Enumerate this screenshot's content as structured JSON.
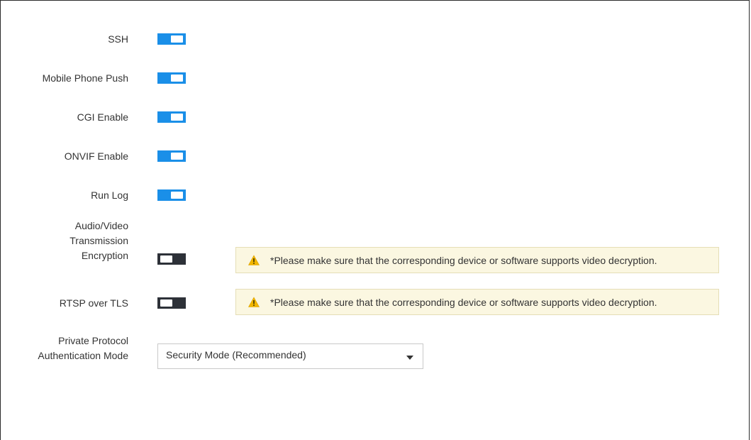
{
  "colors": {
    "toggle_on": "#1a8fe8",
    "toggle_off": "#2d3138",
    "notice_bg": "#fbf7e1",
    "warning_icon": "#f2b600"
  },
  "settings": [
    {
      "label": "SSH",
      "state": "on"
    },
    {
      "label": "Mobile Phone Push",
      "state": "on"
    },
    {
      "label": "CGI Enable",
      "state": "on"
    },
    {
      "label": "ONVIF Enable",
      "state": "on"
    },
    {
      "label": "Run Log",
      "state": "on"
    },
    {
      "label": "Audio/Video\nTransmission\nEncryption",
      "state": "off",
      "notice": "*Please make sure that the corresponding device or software supports video decryption."
    },
    {
      "label": "RTSP over TLS",
      "state": "off",
      "notice": "*Please make sure that the corresponding device or software supports video decryption."
    }
  ],
  "auth_mode": {
    "label": "Private Protocol\nAuthentication Mode",
    "selected": "Security Mode (Recommended)"
  }
}
